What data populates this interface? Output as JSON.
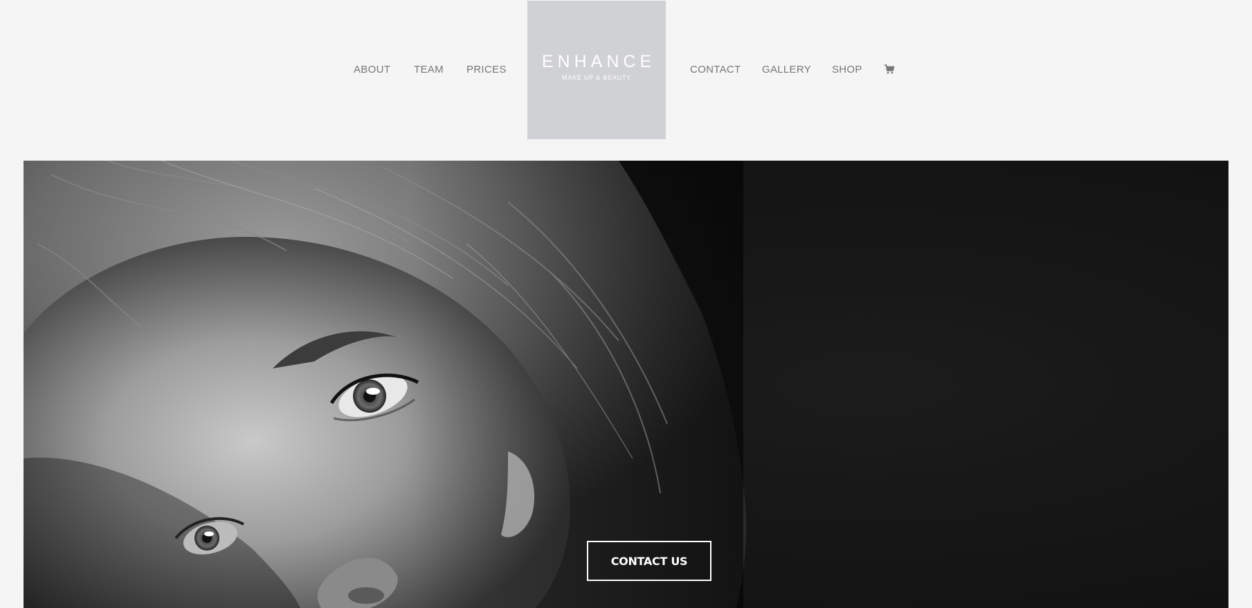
{
  "nav": {
    "left": [
      {
        "label": "ABOUT"
      },
      {
        "label": "TEAM"
      },
      {
        "label": "PRICES"
      }
    ],
    "right": [
      {
        "label": "CONTACT"
      },
      {
        "label": "GALLERY"
      },
      {
        "label": "SHOP"
      }
    ],
    "cart_icon": "shopping-cart-icon"
  },
  "logo": {
    "wordmark": "ENHANCE",
    "tagline": "MAKE UP & BEAUTY",
    "background": "#d0d1d4"
  },
  "hero": {
    "image": "black-and-white close-up portrait of a woman's face",
    "cta_label": "CONTACT US"
  },
  "colors": {
    "page_background": "#f5f5f5",
    "nav_text": "#777777",
    "hero_background": "#151515",
    "cta_border": "#ffffff"
  }
}
